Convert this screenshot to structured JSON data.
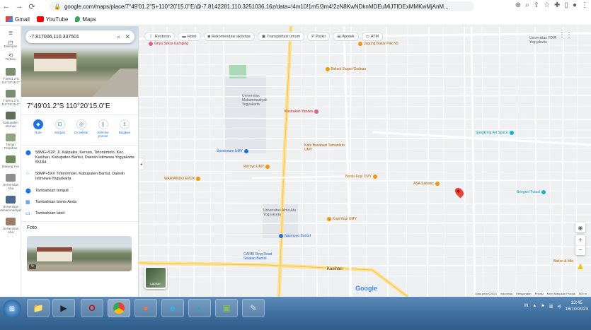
{
  "browser": {
    "url": "google.com/maps/place/7°49'01.2\"S+110°20'15.0\"E/@-7.8142281,110.3251036,16z/data=!4m10!1m5!3m4!2zN8KwNDknMDEuMiJTIDExMMKwMjAnM...",
    "bookmarks": [
      {
        "label": "Gmail",
        "icon": "gmail-icon"
      },
      {
        "label": "YouTube",
        "icon": "youtube-icon"
      },
      {
        "label": "Maps",
        "icon": "maps-icon"
      }
    ]
  },
  "rail": {
    "items": [
      {
        "label": "Disimpan",
        "icon": "bookmark-icon"
      },
      {
        "label": "Terbaru",
        "icon": "history-icon"
      },
      {
        "label": "7°49'01.2\"S 110°20'15.0\""
      },
      {
        "label": "7°49'01.2\"S 110°20'15.0\""
      },
      {
        "label": "Kabupaten Sleman"
      },
      {
        "label": "Taman Pelatihan"
      },
      {
        "label": "Bakung Tiur"
      },
      {
        "label": "Universitas Aha"
      },
      {
        "label": "Universitas Muhammadiyah"
      },
      {
        "label": "Universitas Aha"
      }
    ]
  },
  "panel": {
    "search_value": "-7.817006,110.337501",
    "title": "7°49'01.2\"S 110°20'15.0\"E",
    "actions": [
      {
        "label": "Rute",
        "icon": "directions-icon"
      },
      {
        "label": "Simpan",
        "icon": "bookmark-icon"
      },
      {
        "label": "Di Sekitar",
        "icon": "nearby-icon"
      },
      {
        "label": "Kirim ke ponsel",
        "icon": "phone-icon"
      },
      {
        "label": "Bagikan",
        "icon": "share-icon"
      }
    ],
    "address": "58MG+52P, Jl. Kalipakis, Kersan, Tirtonirmolo, Kec. Kasihan, Kabupaten Bantul, Daerah Istimewa Yogyakarta 55184",
    "plus_code": "58MP+5XX Tirtonirmolo, Kabupaten Bantul, Daerah Istimewa Yogyakarta",
    "add_place": "Tambahkan tempat",
    "add_business": "Tambahkan bisnis Anda",
    "add_label": "Tambahkan label",
    "photos_label": "Foto"
  },
  "map": {
    "chips": [
      {
        "label": "Restoran",
        "icon": "restaurant-icon"
      },
      {
        "label": "Hotel",
        "icon": "hotel-icon"
      },
      {
        "label": "Rekomendasi aktivitas",
        "icon": "camera-icon"
      },
      {
        "label": "Transportasi umum",
        "icon": "transit-icon"
      },
      {
        "label": "Parkir",
        "icon": "parking-icon"
      },
      {
        "label": "Apotek",
        "icon": "pharmacy-icon"
      },
      {
        "label": "ATM",
        "icon": "atm-icon"
      }
    ],
    "pois": [
      {
        "label": "Griya Sekar Gamping",
        "color": "#e8608a",
        "name": "poi-griya-sekar"
      },
      {
        "label": "Universitas Muhammadiyah Yogyakarta",
        "color": "#5f6368",
        "name": "poi-umy"
      },
      {
        "label": "Kostrakan Yandes",
        "color": "#e8608a",
        "name": "poi-kostrakan"
      },
      {
        "label": "Bebek Sarpei Godean",
        "color": "#f29900",
        "name": "poi-bebek"
      },
      {
        "label": "Jagung Bakar Pak No",
        "color": "#f29900",
        "name": "poi-jagung"
      },
      {
        "label": "Sportorium UMY",
        "color": "#1a73e8",
        "name": "poi-sportorium"
      },
      {
        "label": "Kafe Basabasi Tamantirto UMY",
        "color": "#f29900",
        "name": "poi-basabasi"
      },
      {
        "label": "Mirroyo UMY",
        "color": "#f29900",
        "name": "poi-mirroyo"
      },
      {
        "label": "WARMINDO EPOX",
        "color": "#f29900",
        "name": "poi-warmindo"
      },
      {
        "label": "Bento Kopi UMY",
        "color": "#f29900",
        "name": "poi-bento"
      },
      {
        "label": "ASA Saltonic",
        "color": "#f29900",
        "name": "poi-asa"
      },
      {
        "label": "Sangkring Art Space",
        "color": "#12b5cb",
        "name": "poi-sangkring"
      },
      {
        "label": "Bengkel Futsal",
        "color": "#12b5cb",
        "name": "poi-futsal"
      },
      {
        "label": "Universitas Alma Ata Yogyakarta",
        "color": "#5f6368",
        "name": "poi-alma-ata"
      },
      {
        "label": "Kopi Kopi UMY",
        "color": "#f29900",
        "name": "poi-kopikopi"
      },
      {
        "label": "Nasmoco Bantul",
        "color": "#1a73e8",
        "name": "poi-nasmoco"
      },
      {
        "label": "CARBI Ring Road Selatan Bantul",
        "color": "#1a73e8",
        "name": "poi-carbi"
      },
      {
        "label": "Kasihan",
        "color": "#5f6368",
        "name": "poi-kasihan"
      },
      {
        "label": "Bakso & Mie",
        "color": "#f29900",
        "name": "poi-bakso"
      },
      {
        "label": "Universitas YDIR Yogyakarta",
        "color": "#5f6368",
        "name": "poi-ydir"
      }
    ],
    "layers_label": "Lapisan",
    "google_label": "Google",
    "attribution": [
      "Data peta ©2023",
      "Indonesia",
      "Persyaratan",
      "Privasi",
      "Kirim Masukan Produk",
      "500 m"
    ]
  },
  "taskbar": {
    "apps": [
      "explorer-icon",
      "media-player-icon",
      "opera-icon",
      "chrome-icon",
      "firefox-icon",
      "ie-icon",
      "edge-icon",
      "app-icon",
      "paint-icon"
    ],
    "lang": "IN",
    "time": "13:45",
    "date": "16/10/2023"
  }
}
